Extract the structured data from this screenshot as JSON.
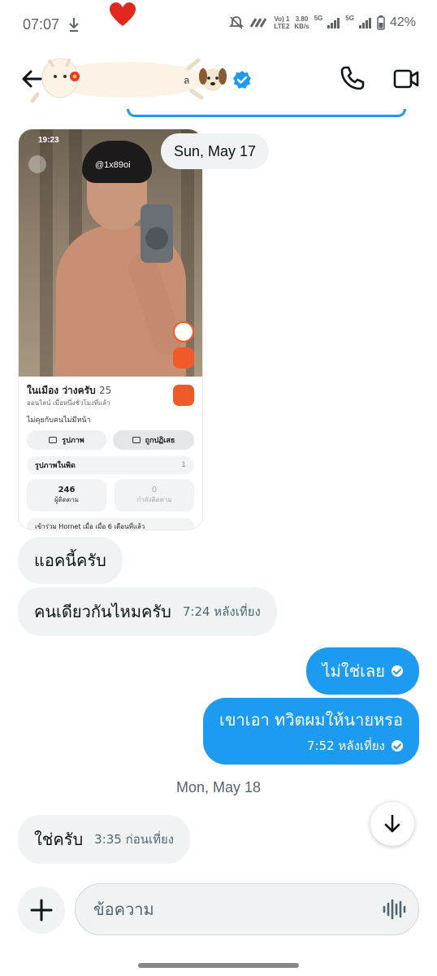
{
  "status_bar": {
    "time": "07:07",
    "net_top": "Vo) 1",
    "net_bottom": "LTE2",
    "speed_top": "3.80",
    "speed_bottom": "KB/s",
    "sig1": "5G",
    "sig2": "5G",
    "battery": "42%"
  },
  "header": {
    "name_fragment": "ล"
  },
  "profile_card": {
    "status_time": "19:23",
    "handle": "@1x89oi",
    "name": "ในเมือง ว่างครับ",
    "age": "25",
    "online": "ออนไลน์ เมื่อหนึ่งชั่วโมงที่แล้ว",
    "bio": "ไม่คุยกับคนไม่มีหน้า",
    "photos_btn": "รูปภาพ",
    "rejected_btn": "ถูกปฏิเสธ",
    "private_photos": "รูปภาพในพิด",
    "private_count": "1",
    "followers_count": "246",
    "followers_label": "ผู้ติดตาม",
    "following_count": "0",
    "following_label": "กำลังติดตาม",
    "joined": "เข้าร่วม Hornet เมื่อ เมื่อ 6 เดือนที่แล้ว"
  },
  "dates": {
    "first": "Sun, May 17",
    "second": "Mon, May 18"
  },
  "messages": [
    {
      "text": "แอคนี้ครับ",
      "time": ""
    },
    {
      "text": "คนเดียวกันไหมครับ",
      "time": "7:24 หลังเที่ยง"
    },
    {
      "text": "ไม่ใช่เลย",
      "time": ""
    },
    {
      "text": "เขาเอา ทวิตผมให้นายหรอ",
      "time": "7:52 หลังเที่ยง"
    },
    {
      "text": "ใช่ครับ",
      "time": "3:35 ก่อนเที่ยง"
    }
  ],
  "composer": {
    "placeholder": "ข้อความ"
  },
  "colors": {
    "accent": "#1d9bf0",
    "incoming_bg": "#eff3f4",
    "hornet_orange": "#f05a28"
  }
}
